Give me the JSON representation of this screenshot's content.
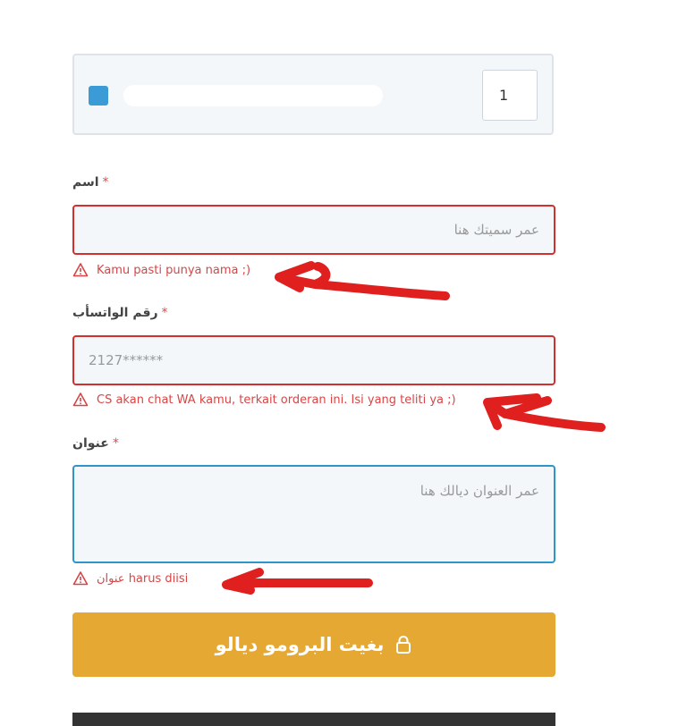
{
  "product": {
    "quantity": "1",
    "swatch_color": "#3a9bd6"
  },
  "name_field": {
    "label": "اسم",
    "required_mark": "*",
    "placeholder": "عمر سميتك هنا",
    "error": "Kamu pasti punya nama ;)"
  },
  "whatsapp_field": {
    "label": "رقم الواتسأب",
    "required_mark": "*",
    "placeholder": "2127******",
    "error": "CS akan chat WA kamu, terkait orderan ini. Isi yang teliti ya ;)"
  },
  "address_field": {
    "label": "عنوان",
    "required_mark": "*",
    "placeholder": "عمر العنوان ديالك هنا",
    "error": "عنوان harus diisi"
  },
  "submit": {
    "label": "بغيت البرومو ديالو",
    "icon": "lock-icon"
  },
  "colors": {
    "accent": "#e5a833",
    "error": "#d94545",
    "focus": "#2f95c9",
    "annotation": "#e01f1f"
  }
}
